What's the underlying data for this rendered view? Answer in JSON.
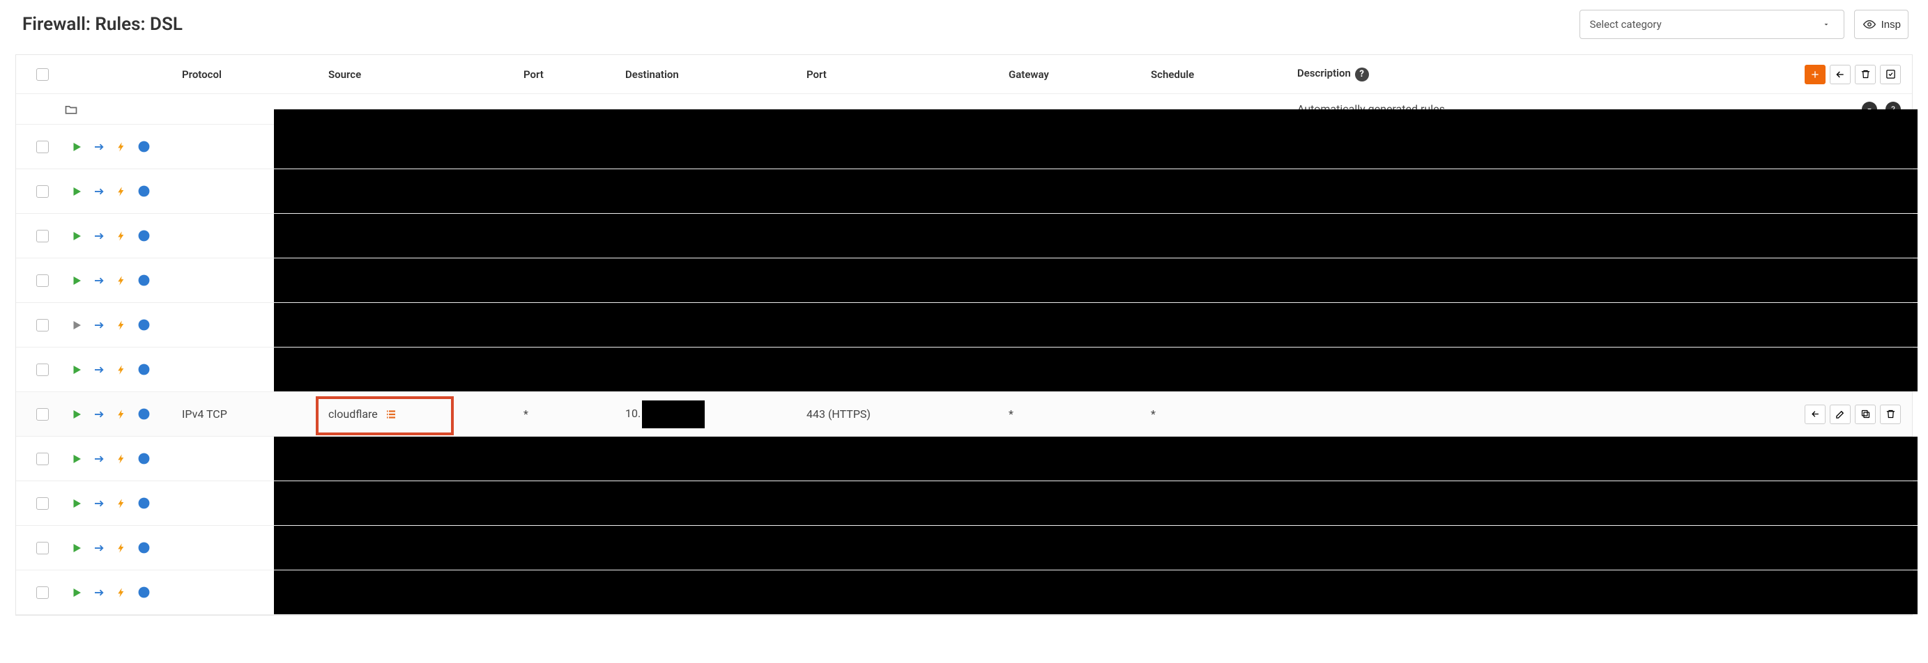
{
  "header": {
    "title": "Firewall: Rules: DSL",
    "select_placeholder": "Select category",
    "inspect_label": "Insp"
  },
  "columns": {
    "protocol": "Protocol",
    "source": "Source",
    "port1": "Port",
    "destination": "Destination",
    "port2": "Port",
    "gateway": "Gateway",
    "schedule": "Schedule",
    "description": "Description"
  },
  "autorow": {
    "description": "Automatically generated rules",
    "count": "?"
  },
  "visible_rule": {
    "protocol": "IPv4 TCP",
    "source": "cloudflare",
    "port_src": "*",
    "dest_prefix": "10.",
    "dest_redacted": "",
    "port_dst": "443 (HTTPS)",
    "gateway": "*",
    "schedule": "*"
  }
}
